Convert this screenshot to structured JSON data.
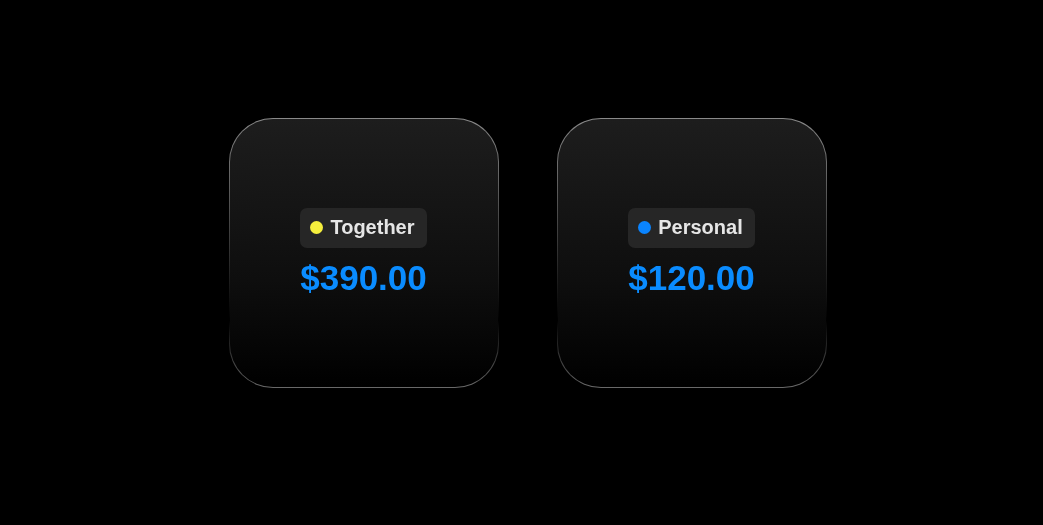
{
  "cards": [
    {
      "label": "Together",
      "color": "#f5ef3d",
      "amount": "$390.00"
    },
    {
      "label": "Personal",
      "color": "#0a84ff",
      "amount": "$120.00"
    }
  ]
}
